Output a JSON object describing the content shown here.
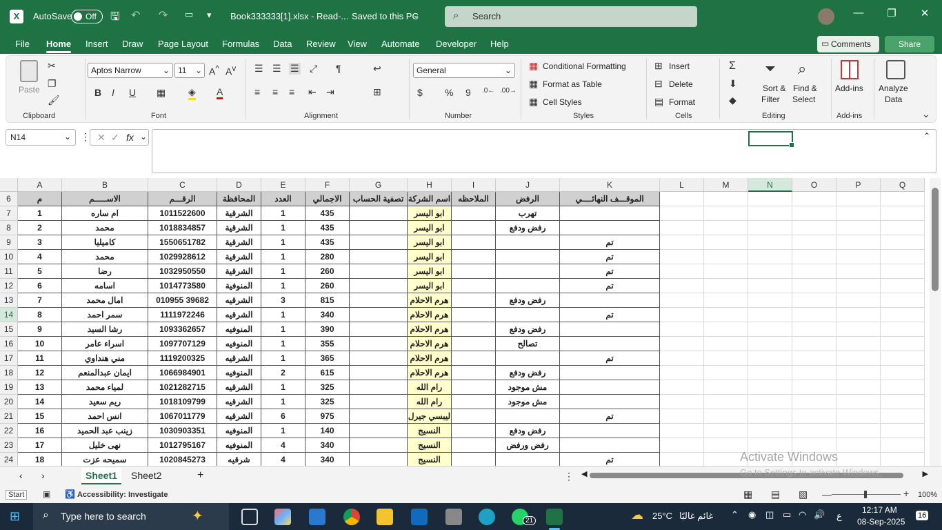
{
  "titlebar": {
    "autosave": "AutoSave",
    "toggle": "Off",
    "filename": "Book333333[1].xlsx  -  Read-...",
    "saved": "Saved to this PC",
    "search_placeholder": "Search"
  },
  "menu": [
    "File",
    "Home",
    "Insert",
    "Draw",
    "Page Layout",
    "Formulas",
    "Data",
    "Review",
    "View",
    "Automate",
    "Developer",
    "Help"
  ],
  "buttons": {
    "comments": "Comments",
    "share": "Share"
  },
  "ribbon": {
    "paste": "Paste",
    "font_name": "Aptos Narrow",
    "font_size": "11",
    "number_format": "General",
    "conditional": "Conditional Formatting",
    "format_table": "Format as Table",
    "cell_styles": "Cell Styles",
    "insert": "Insert",
    "delete": "Delete",
    "format": "Format",
    "sort": "Sort &",
    "sort2": "Filter",
    "find": "Find &",
    "find2": "Select",
    "addins": "Add-ins",
    "analyze": "Analyze",
    "analyze2": "Data",
    "groups": [
      "Clipboard",
      "Font",
      "Alignment",
      "Number",
      "Styles",
      "Cells",
      "Editing",
      "Add-ins"
    ]
  },
  "namebox": "N14",
  "columns": [
    "A",
    "B",
    "C",
    "D",
    "E",
    "F",
    "G",
    "H",
    "I",
    "J",
    "K",
    "L",
    "M",
    "N",
    "O",
    "P",
    "Q"
  ],
  "header_row": [
    "م",
    "الاســـــم",
    "الرقـــم",
    "المحافظة",
    "العدد",
    "الاجمالي",
    "تصفية الحساب",
    "اسم الشركة",
    "الملاحظه",
    "الرفض",
    "الموقـــف النهائــــي"
  ],
  "rows": [
    {
      "r": "7",
      "c": [
        "1",
        "ام ساره",
        "1011522600",
        "الشرقية",
        "1",
        "435",
        "",
        "ابو اليسر",
        "",
        "تهرب",
        ""
      ]
    },
    {
      "r": "8",
      "c": [
        "2",
        "محمد",
        "1018834857",
        "الشرقية",
        "1",
        "435",
        "",
        "ابو اليسر",
        "",
        "رفض ودفع",
        ""
      ]
    },
    {
      "r": "9",
      "c": [
        "3",
        "كاميليا",
        "1550651782",
        "الشرقية",
        "1",
        "435",
        "",
        "ابو اليسر",
        "",
        "",
        "تم"
      ]
    },
    {
      "r": "10",
      "c": [
        "4",
        "محمد",
        "1029928612",
        "الشرقية",
        "1",
        "280",
        "",
        "ابو اليسر",
        "",
        "",
        "تم"
      ]
    },
    {
      "r": "11",
      "c": [
        "5",
        "رضا",
        "1032950550",
        "الشرقية",
        "1",
        "260",
        "",
        "ابو اليسر",
        "",
        "",
        "تم"
      ]
    },
    {
      "r": "12",
      "c": [
        "6",
        "اسامه",
        "1014773580",
        "المنوفية",
        "1",
        "260",
        "",
        "ابو اليسر",
        "",
        "",
        "تم"
      ]
    },
    {
      "r": "13",
      "c": [
        "7",
        "امال محمد",
        "010955 39682",
        "الشرقيه",
        "3",
        "815",
        "",
        "هرم الاحلام",
        "",
        "رفض ودفع",
        ""
      ]
    },
    {
      "r": "14",
      "c": [
        "8",
        "سمر احمد",
        "1111972246",
        "الشرقيه",
        "1",
        "340",
        "",
        "هرم الاحلام",
        "",
        "",
        "تم"
      ]
    },
    {
      "r": "15",
      "c": [
        "9",
        "رشا السيد",
        "1093362657",
        "المنوفيه",
        "1",
        "390",
        "",
        "هرم الاحلام",
        "",
        "رفض ودفع",
        ""
      ]
    },
    {
      "r": "16",
      "c": [
        "10",
        "اسراء عامر",
        "1097707129",
        "المنوفيه",
        "1",
        "355",
        "",
        "هرم الاحلام",
        "",
        "تصالح",
        ""
      ]
    },
    {
      "r": "17",
      "c": [
        "11",
        "مني هنداوي",
        "1119200325",
        "الشرقيه",
        "1",
        "365",
        "",
        "هرم الاحلام",
        "",
        "",
        "تم"
      ]
    },
    {
      "r": "18",
      "c": [
        "12",
        "ايمان عبدالمنعم",
        "1066984901",
        "المنوفيه",
        "2",
        "615",
        "",
        "هرم الاحلام",
        "",
        "رفض ودفع",
        ""
      ]
    },
    {
      "r": "19",
      "c": [
        "13",
        "لمياء محمد",
        "1021282715",
        "الشرقيه",
        "1",
        "325",
        "",
        "رام الله",
        "",
        "مش موجود",
        ""
      ]
    },
    {
      "r": "20",
      "c": [
        "14",
        "ريم سعيد",
        "1018109799",
        "الشرقيه",
        "1",
        "325",
        "",
        "رام الله",
        "",
        "مش موجود",
        ""
      ]
    },
    {
      "r": "21",
      "c": [
        "15",
        "انس احمد",
        "1067011779",
        "الشرقيه",
        "6",
        "975",
        "",
        "ليبسي جيرل",
        "",
        "",
        "تم"
      ]
    },
    {
      "r": "22",
      "c": [
        "16",
        "زينب عبد الحميد",
        "1030903351",
        "المنوفيه",
        "1",
        "140",
        "",
        "النسيج",
        "",
        "رفض ودفع",
        ""
      ]
    },
    {
      "r": "23",
      "c": [
        "17",
        "نهى خليل",
        "1012795167",
        "المنوفيه",
        "4",
        "340",
        "",
        "النسيج",
        "",
        "رفض ورفض",
        ""
      ]
    },
    {
      "r": "24",
      "c": [
        "18",
        "سميحه عزت",
        "1020845273",
        "شرقيه",
        "4",
        "340",
        "",
        "النسيج",
        "",
        "",
        "تم"
      ]
    }
  ],
  "sheets": [
    "Sheet1",
    "Sheet2"
  ],
  "status": {
    "mode": "Start",
    "accessibility": "Accessibility: Investigate",
    "zoom": "100%"
  },
  "watermark": {
    "line1": "Activate Windows",
    "line2": "Go to Settings to activate Windows."
  },
  "taskbar": {
    "search": "Type here to search",
    "temp": "25°C",
    "weather": "غائم غالبًا",
    "lang": "ع",
    "time": "12:17 AM",
    "date": "08-Sep-2025",
    "notif": "16",
    "badge": "21"
  },
  "colors": {
    "excel_green": "#1f7244",
    "header_gray": "#d0d0d0",
    "yellow": "#ffffcc"
  }
}
